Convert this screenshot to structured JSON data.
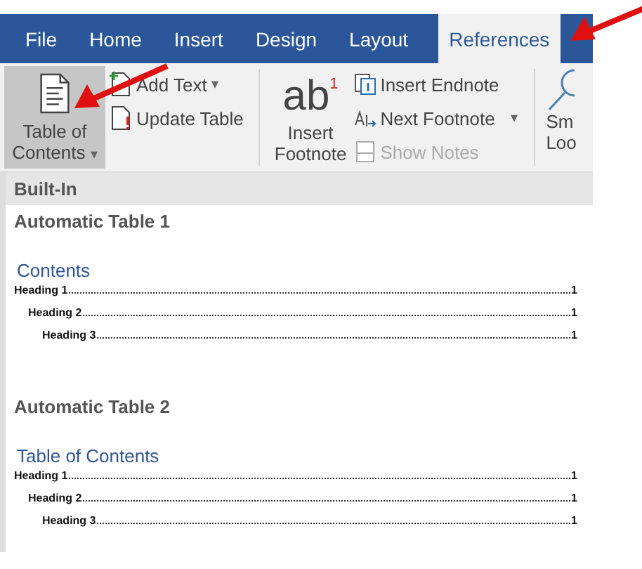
{
  "tabs": [
    {
      "label": "File",
      "selected": false
    },
    {
      "label": "Home",
      "selected": false
    },
    {
      "label": "Insert",
      "selected": false
    },
    {
      "label": "Design",
      "selected": false
    },
    {
      "label": "Layout",
      "selected": false
    },
    {
      "label": "References",
      "selected": true
    }
  ],
  "ribbon": {
    "toc_button": {
      "label_lines": [
        "Table of",
        "Contents"
      ],
      "caret": "▾",
      "selected": true
    },
    "toc_small": [
      {
        "label": "Add Text",
        "caret": "▾"
      },
      {
        "label": "Update Table"
      }
    ],
    "footnote_button": {
      "glyph": "ab",
      "superscript": "1",
      "label_lines": [
        "Insert",
        "Footnote"
      ]
    },
    "footnote_small": [
      {
        "label": "Insert Endnote",
        "disabled": false
      },
      {
        "label": "Next Footnote",
        "caret": "▾",
        "disabled": false
      },
      {
        "label": "Show Notes",
        "disabled": true
      }
    ],
    "cut_button": {
      "label_lines": [
        "Sm",
        "Loo"
      ]
    }
  },
  "gallery": {
    "section": "Built-In",
    "items": [
      {
        "title": "Automatic Table 1",
        "heading": "Contents",
        "entries": [
          {
            "text": "Heading 1",
            "page": "1",
            "children": [
              {
                "text": "Heading 2",
                "page": "1",
                "children": [
                  {
                    "text": "Heading 3",
                    "page": "1"
                  }
                ]
              }
            ]
          }
        ]
      },
      {
        "title": "Automatic Table 2",
        "heading": "Table of Contents",
        "entries": [
          {
            "text": "Heading 1",
            "page": "1",
            "children": [
              {
                "text": "Heading 2",
                "page": "1",
                "children": [
                  {
                    "text": "Heading 3",
                    "page": "1"
                  }
                ]
              }
            ]
          }
        ]
      }
    ]
  }
}
